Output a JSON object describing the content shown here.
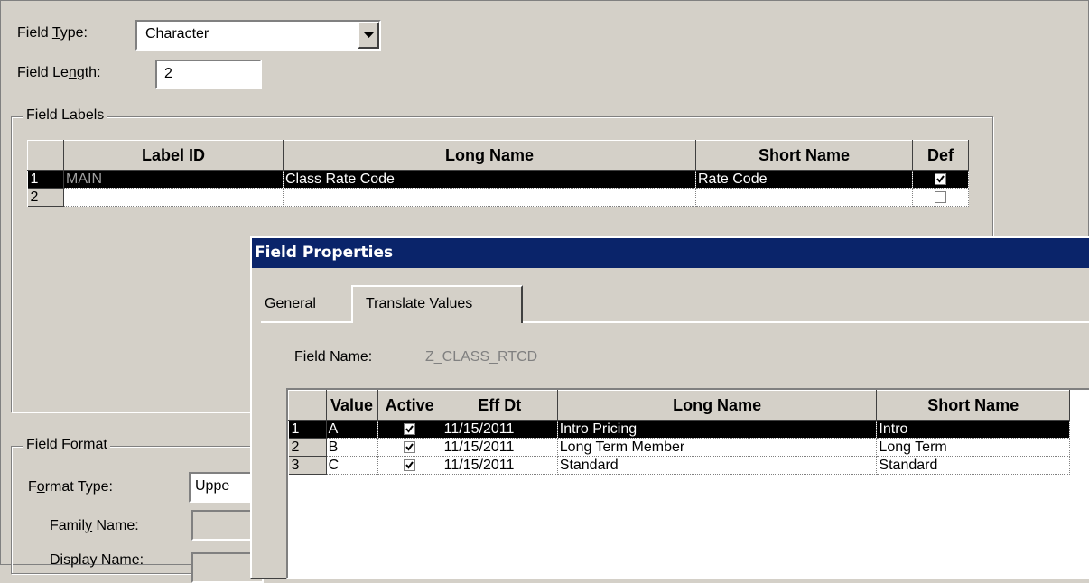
{
  "field_type": {
    "label_pre": "Field ",
    "label_u": "T",
    "label_post": "ype:",
    "value": "Character"
  },
  "field_length": {
    "label_pre": "Field Le",
    "label_u": "n",
    "label_post": "gth:",
    "value": "2"
  },
  "field_labels": {
    "legend": "Field Labels",
    "columns": [
      "",
      "Label ID",
      "Long Name",
      "Short Name",
      "Def"
    ],
    "rows": [
      {
        "num": "1",
        "label_id": "MAIN",
        "long_name": "Class Rate Code",
        "short_name": "Rate Code",
        "def": true
      },
      {
        "num": "2",
        "label_id": "",
        "long_name": "",
        "short_name": "",
        "def": false
      }
    ]
  },
  "field_format": {
    "legend": "Field Format",
    "format_type_label_pre": "F",
    "format_type_label_u": "o",
    "format_type_label_post": "rmat Type:",
    "format_type_value": "Uppe",
    "family_name_pre": "Famil",
    "family_name_u": "y",
    "family_name_post": " Name:",
    "display_name": "Display Name:"
  },
  "dialog": {
    "title": "Field Properties",
    "tabs": [
      "General",
      "Translate Values"
    ],
    "active_tab": "Translate Values",
    "field_name_label": "Field Name:",
    "field_name_value": "Z_CLASS_RTCD",
    "translate_table": {
      "columns": [
        "",
        "Value",
        "Active",
        "Eff Dt",
        "Long Name",
        "Short Name"
      ],
      "rows": [
        {
          "num": "1",
          "value": "A",
          "active": true,
          "eff_dt": "11/15/2011",
          "long_name": "Intro Pricing",
          "short_name": "Intro"
        },
        {
          "num": "2",
          "value": "B",
          "active": true,
          "eff_dt": "11/15/2011",
          "long_name": "Long Term Member",
          "short_name": "Long Term"
        },
        {
          "num": "3",
          "value": "C",
          "active": true,
          "eff_dt": "11/15/2011",
          "long_name": "Standard",
          "short_name": "Standard"
        }
      ]
    }
  },
  "colors": {
    "window_bg": "#d4d0c8",
    "title_bar": "#0a246a",
    "selection": "#000000"
  }
}
